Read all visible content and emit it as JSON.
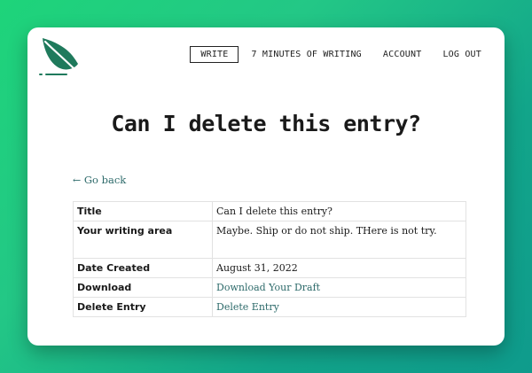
{
  "nav": {
    "items": [
      {
        "label": "WRITE",
        "active": true
      },
      {
        "label": "7 MINUTES OF WRITING",
        "active": false
      },
      {
        "label": "ACCOUNT",
        "active": false
      },
      {
        "label": "LOG OUT",
        "active": false
      }
    ]
  },
  "page": {
    "title": "Can I delete this entry?",
    "back_arrow": "←",
    "back_label": "Go back"
  },
  "details": {
    "rows": [
      {
        "label": "Title",
        "value": "Can I delete this entry?"
      },
      {
        "label": "Your writing area",
        "value": "Maybe. Ship or do not ship. THere is not try."
      },
      {
        "label": "Date Created",
        "value": "August 31, 2022"
      },
      {
        "label": "Download",
        "value": "Download Your Draft"
      },
      {
        "label": "Delete Entry",
        "value": "Delete Entry"
      }
    ]
  },
  "colors": {
    "brand": "#1f7a5c",
    "link": "#2d6a6a",
    "background_start": "#1ed47a",
    "background_end": "#0f9b8c"
  },
  "icons": {
    "logo": "leaf-icon"
  }
}
